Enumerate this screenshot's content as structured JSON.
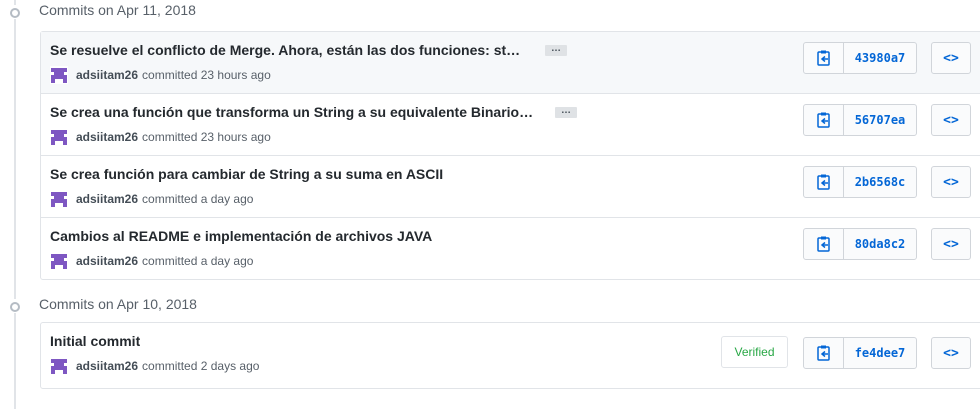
{
  "groups": [
    {
      "title": "Commits on Apr 11, 2018",
      "commits": [
        {
          "title": "Se resuelve el conflicto de Merge. Ahora, están las dos funciones: st…",
          "expander": "…",
          "author": "adsiitam26",
          "time": "committed 23 hours ago",
          "sha": "43980a7",
          "verified": ""
        },
        {
          "title": "Se crea una función que transforma un String a su equivalente Binario…",
          "expander": "…",
          "author": "adsiitam26",
          "time": "committed 23 hours ago",
          "sha": "56707ea",
          "verified": ""
        },
        {
          "title": "Se crea función para cambiar de String a su suma en ASCII",
          "expander": "",
          "author": "adsiitam26",
          "time": "committed a day ago",
          "sha": "2b6568c",
          "verified": ""
        },
        {
          "title": "Cambios al README e implementación de archivos JAVA",
          "expander": "",
          "author": "adsiitam26",
          "time": "committed a day ago",
          "sha": "80da8c2",
          "verified": ""
        }
      ]
    },
    {
      "title": "Commits on Apr 10, 2018",
      "commits": [
        {
          "title": "Initial commit",
          "expander": "",
          "author": "adsiitam26",
          "time": "committed 2 days ago",
          "sha": "fe4dee7",
          "verified": "Verified"
        }
      ]
    }
  ],
  "icons": {
    "avatar": "identicon-avatar-icon",
    "copy": "clipboard-copy-icon",
    "browse": "code-browse-icon",
    "timeline": "commit-node-icon"
  },
  "colors": {
    "link": "#0366d6",
    "verified": "#28a745",
    "avatar": "#7e57c2",
    "highlight": "#f6f8fa"
  }
}
